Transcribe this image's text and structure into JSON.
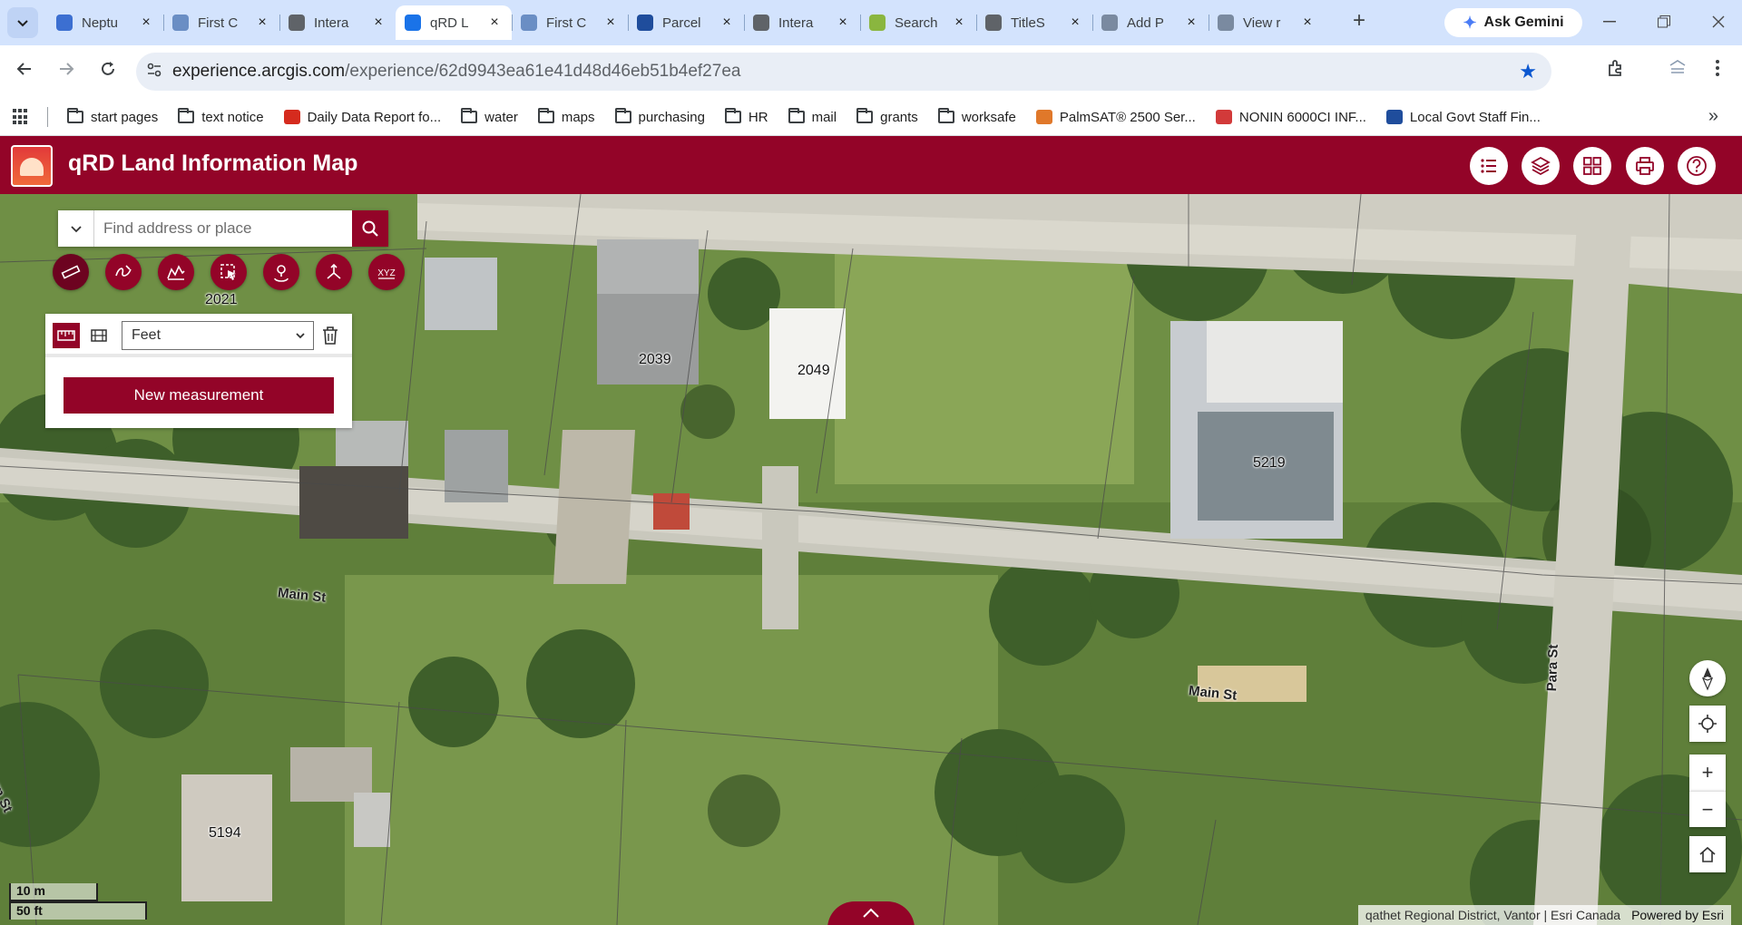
{
  "browser": {
    "tabs": [
      {
        "label": "Neptu",
        "active": false,
        "favicon_color": "#3c6fd1"
      },
      {
        "label": "First C",
        "active": false,
        "favicon_color": "#6a8ec4"
      },
      {
        "label": "Intera",
        "active": false,
        "favicon_color": "#5f6368"
      },
      {
        "label": "qRD L",
        "active": true,
        "favicon_color": "#1a73e8"
      },
      {
        "label": "First C",
        "active": false,
        "favicon_color": "#6a8ec4"
      },
      {
        "label": "Parcel",
        "active": false,
        "favicon_color": "#1f4d9c"
      },
      {
        "label": "Intera",
        "active": false,
        "favicon_color": "#5f6368"
      },
      {
        "label": "Search",
        "active": false,
        "favicon_color": "#8ab63f"
      },
      {
        "label": "TitleS",
        "active": false,
        "favicon_color": "#5f6368"
      },
      {
        "label": "Add P",
        "active": false,
        "favicon_color": "#7a8aa0"
      },
      {
        "label": "View r",
        "active": false,
        "favicon_color": "#7a8aa0"
      }
    ],
    "new_tab": "+",
    "gemini_label": "Ask Gemini",
    "url_host": "experience.arcgis.com",
    "url_path": "/experience/62d9943ea61e41d48d46eb51b4ef27ea",
    "bookmarks": [
      {
        "label": "start pages",
        "icon": "folder"
      },
      {
        "label": "text notice",
        "icon": "folder"
      },
      {
        "label": "Daily Data Report fo...",
        "icon": "maple-leaf",
        "color": "#d52b1e"
      },
      {
        "label": "water",
        "icon": "folder"
      },
      {
        "label": "maps",
        "icon": "folder"
      },
      {
        "label": "purchasing",
        "icon": "folder"
      },
      {
        "label": "HR",
        "icon": "folder"
      },
      {
        "label": "mail",
        "icon": "folder"
      },
      {
        "label": "grants",
        "icon": "folder"
      },
      {
        "label": "worksafe",
        "icon": "folder"
      },
      {
        "label": "PalmSAT® 2500 Ser...",
        "icon": "palmsat",
        "color": "#e0782a"
      },
      {
        "label": "NONIN 6000CI INF...",
        "icon": "nonin",
        "color": "#d23a3a"
      },
      {
        "label": "Local Govt Staff Fin...",
        "icon": "bc-flag",
        "color": "#1f4d9c"
      }
    ]
  },
  "app": {
    "title": "qRD Land Information Map",
    "brand_color": "#930428",
    "header_icons": [
      "list-icon",
      "layers-icon",
      "basemap-gallery-icon",
      "print-icon",
      "help-icon"
    ]
  },
  "search": {
    "placeholder": "Find address or place"
  },
  "tools": [
    "measure-icon",
    "sketch-icon",
    "elevation-profile-icon",
    "select-icon",
    "coordinate-icon",
    "directions-icon",
    "xyz-icon"
  ],
  "measure_panel": {
    "unit": "Feet",
    "new_button": "New measurement"
  },
  "map": {
    "parcels": [
      "2021",
      "2039",
      "2049",
      "5219",
      "5194"
    ],
    "streets": [
      "Main St",
      "Main St",
      "Para St",
      "born St"
    ],
    "scale": {
      "metric": "10 m",
      "imperial": "50 ft"
    },
    "attribution": "qathet Regional District, Vantor | Esri Canada",
    "powered_by": "Powered by Esri",
    "controls": {
      "zoom_in": "+",
      "zoom_out": "−"
    }
  }
}
